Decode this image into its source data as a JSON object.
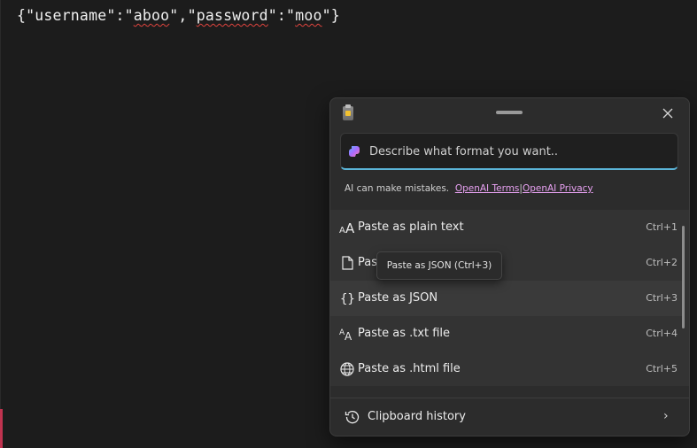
{
  "editor": {
    "line_parts": [
      "{\"username\":\"",
      "aboo",
      "\",\"",
      "password",
      "\":\"",
      "moo",
      "\"}"
    ]
  },
  "panel": {
    "prompt_placeholder": "Describe what format you want..",
    "disclaimer_text": "AI can make mistakes.",
    "terms_link": "OpenAI Terms",
    "separator": "|",
    "privacy_link": "OpenAI Privacy",
    "items": [
      {
        "icon": "text-size-icon",
        "label": "Paste as plain text",
        "shortcut": "Ctrl+1"
      },
      {
        "icon": "document-icon",
        "label": "Past",
        "shortcut": "Ctrl+2"
      },
      {
        "icon": "braces-icon",
        "label": "Paste as JSON",
        "shortcut": "Ctrl+3"
      },
      {
        "icon": "text-file-icon",
        "label": "Paste as .txt file",
        "shortcut": "Ctrl+4"
      },
      {
        "icon": "globe-icon",
        "label": "Paste as .html file",
        "shortcut": "Ctrl+5"
      }
    ],
    "tooltip": "Paste as JSON (Ctrl+3)",
    "history_label": "Clipboard history"
  },
  "colors": {
    "accent_underline": "#5bb5d8",
    "link": "#e6a0f0",
    "spellcheck": "#e0443e"
  }
}
